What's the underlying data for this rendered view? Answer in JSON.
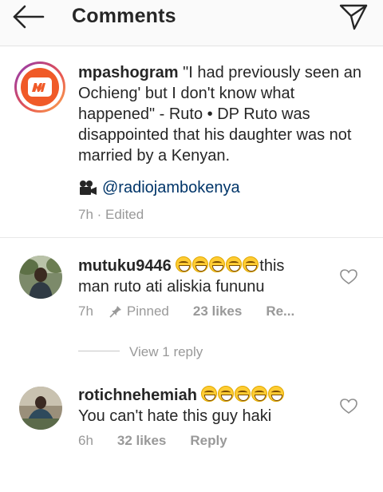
{
  "header": {
    "title": "Comments",
    "back_icon": "arrow-left-icon",
    "send_icon": "paper-plane-icon"
  },
  "caption": {
    "username": "mpashogram",
    "text": " \"I had previously seen an Ochieng' but I don't know what happened\" - Ruto • DP Ruto was disappointed that his daughter was not married by a Kenyan.",
    "camera_icon": "movie-camera-icon",
    "mention": "@radiojambokenya",
    "time": "7h · Edited",
    "logo_colors": {
      "bg": "#f05a28"
    }
  },
  "comments": [
    {
      "username": "mutuku9446",
      "emoji_count": 5,
      "text_after_emoji": "this",
      "text_line2": "man ruto ati aliskia fununu",
      "time": "7h",
      "pinned": "Pinned",
      "likes": "23 likes",
      "reply": "Re...",
      "view_replies": "View 1 reply"
    },
    {
      "username": "rotichnehemiah",
      "emoji_count": 5,
      "text_line2": "You can't hate this guy haki",
      "time": "6h",
      "likes": "32 likes",
      "reply": "Reply"
    }
  ],
  "colors": {
    "text": "#262626",
    "muted": "#999999",
    "link": "#003569",
    "emoji": "#ffcc33"
  }
}
